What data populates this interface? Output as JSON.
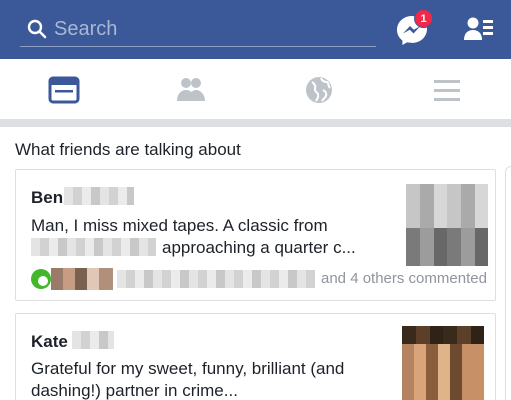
{
  "search": {
    "placeholder": "Search"
  },
  "messenger": {
    "badge": "1"
  },
  "tabs": [
    {
      "name": "news-feed",
      "active": true
    },
    {
      "name": "friends",
      "active": false
    },
    {
      "name": "notifications",
      "active": false
    },
    {
      "name": "menu",
      "active": false
    }
  ],
  "colors": {
    "brand": "#3b5998",
    "badge": "#f02849",
    "active_tab": "#3b5998",
    "inactive_tab": "#bec3c9",
    "comment_icon": "#42b72a"
  },
  "section": {
    "title": "What friends are talking about"
  },
  "posts": [
    {
      "author": "Ben",
      "text_line1": "Man, I miss mixed tapes. A classic from",
      "text_line2": "approaching a quarter c...",
      "others": "and 4 others commented"
    },
    {
      "author": "Kate",
      "text_line1": "Grateful for my sweet, funny, brilliant (and",
      "text_line2": "dashing!) partner in crime..."
    }
  ]
}
